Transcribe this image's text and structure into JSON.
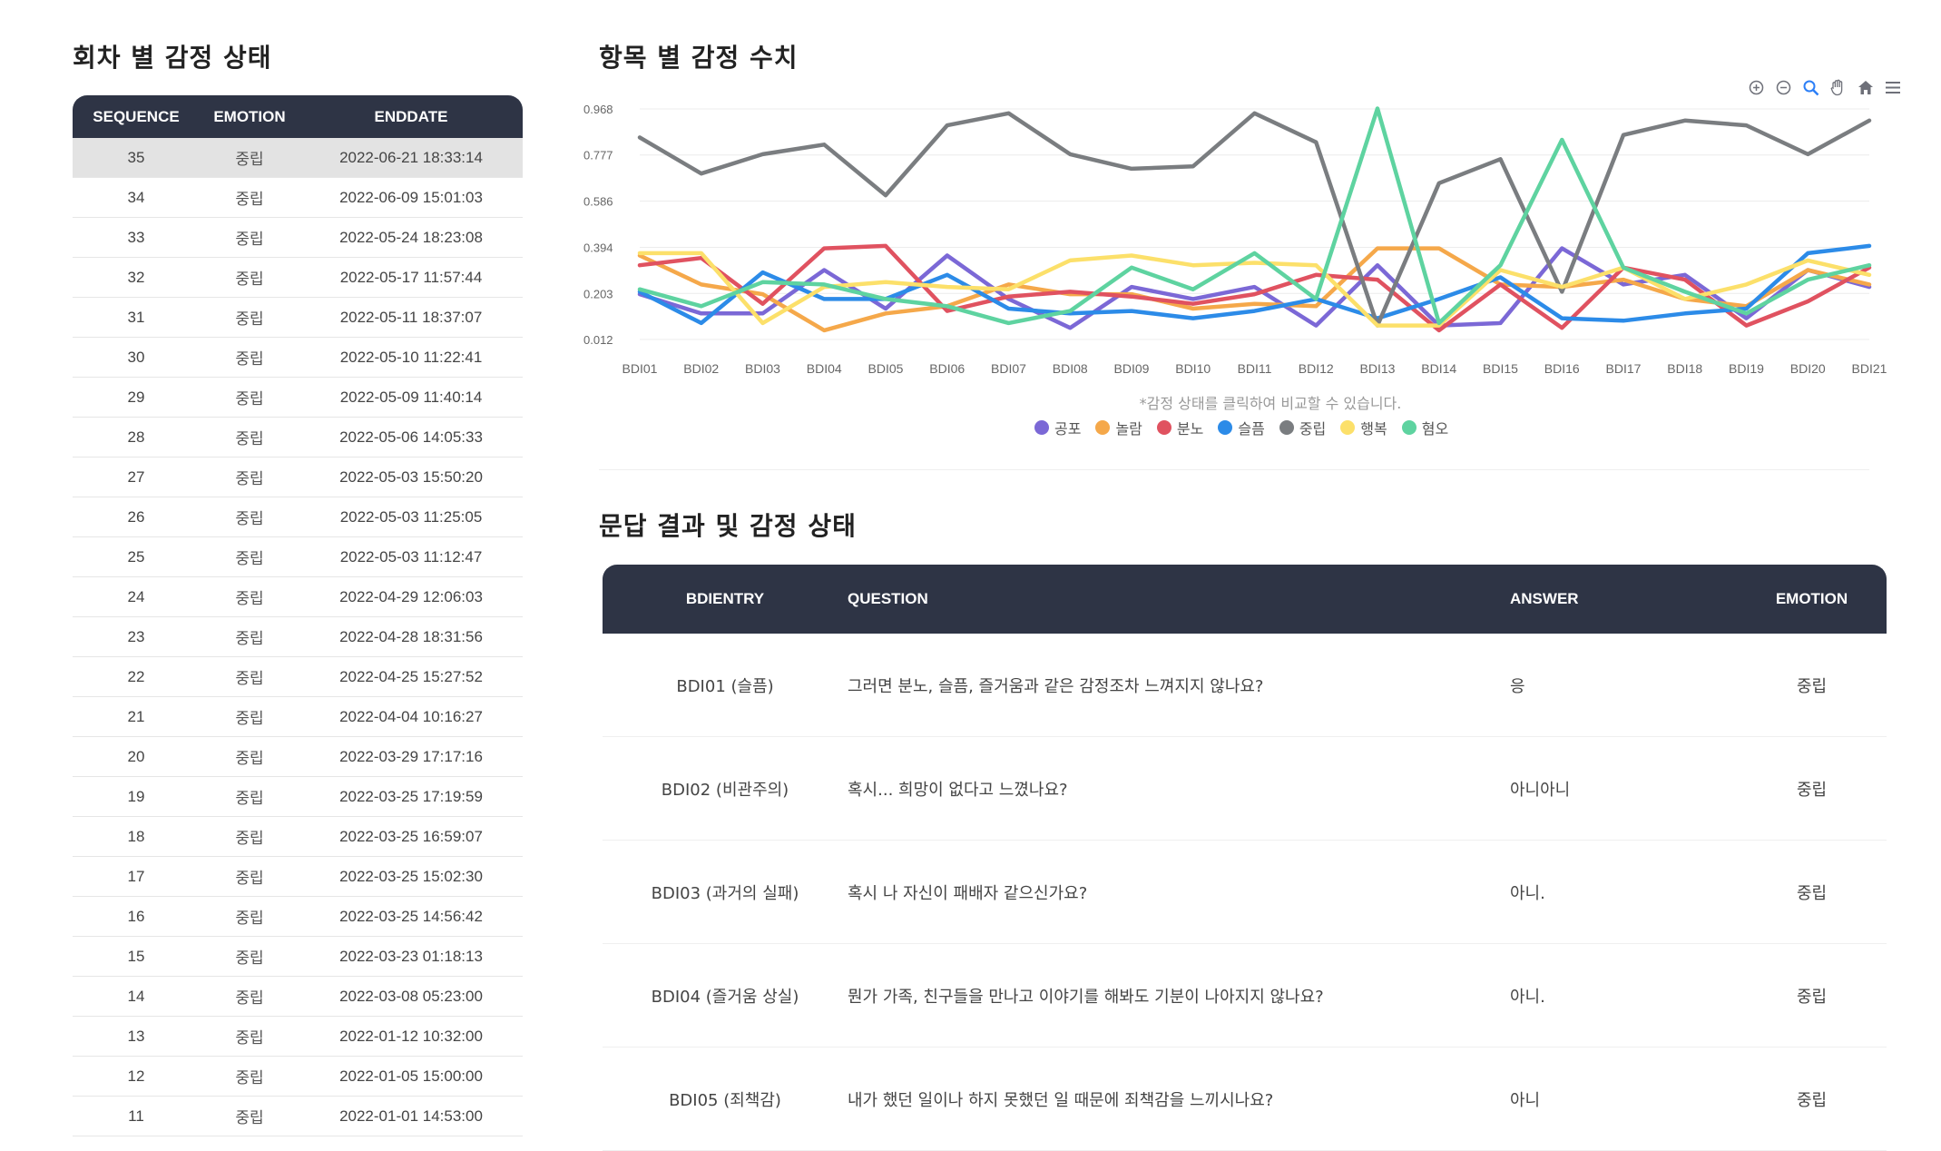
{
  "session_panel": {
    "title": "회차 별 감정 상태",
    "headers": [
      "SEQUENCE",
      "EMOTION",
      "ENDDATE"
    ],
    "rows": [
      {
        "seq": "35",
        "emotion": "중립",
        "end": "2022-06-21 18:33:14"
      },
      {
        "seq": "34",
        "emotion": "중립",
        "end": "2022-06-09 15:01:03"
      },
      {
        "seq": "33",
        "emotion": "중립",
        "end": "2022-05-24 18:23:08"
      },
      {
        "seq": "32",
        "emotion": "중립",
        "end": "2022-05-17 11:57:44"
      },
      {
        "seq": "31",
        "emotion": "중립",
        "end": "2022-05-11 18:37:07"
      },
      {
        "seq": "30",
        "emotion": "중립",
        "end": "2022-05-10 11:22:41"
      },
      {
        "seq": "29",
        "emotion": "중립",
        "end": "2022-05-09 11:40:14"
      },
      {
        "seq": "28",
        "emotion": "중립",
        "end": "2022-05-06 14:05:33"
      },
      {
        "seq": "27",
        "emotion": "중립",
        "end": "2022-05-03 15:50:20"
      },
      {
        "seq": "26",
        "emotion": "중립",
        "end": "2022-05-03 11:25:05"
      },
      {
        "seq": "25",
        "emotion": "중립",
        "end": "2022-05-03 11:12:47"
      },
      {
        "seq": "24",
        "emotion": "중립",
        "end": "2022-04-29 12:06:03"
      },
      {
        "seq": "23",
        "emotion": "중립",
        "end": "2022-04-28 18:31:56"
      },
      {
        "seq": "22",
        "emotion": "중립",
        "end": "2022-04-25 15:27:52"
      },
      {
        "seq": "21",
        "emotion": "중립",
        "end": "2022-04-04 10:16:27"
      },
      {
        "seq": "20",
        "emotion": "중립",
        "end": "2022-03-29 17:17:16"
      },
      {
        "seq": "19",
        "emotion": "중립",
        "end": "2022-03-25 17:19:59"
      },
      {
        "seq": "18",
        "emotion": "중립",
        "end": "2022-03-25 16:59:07"
      },
      {
        "seq": "17",
        "emotion": "중립",
        "end": "2022-03-25 15:02:30"
      },
      {
        "seq": "16",
        "emotion": "중립",
        "end": "2022-03-25 14:56:42"
      },
      {
        "seq": "15",
        "emotion": "중립",
        "end": "2022-03-23 01:18:13"
      },
      {
        "seq": "14",
        "emotion": "중립",
        "end": "2022-03-08 05:23:00"
      },
      {
        "seq": "13",
        "emotion": "중립",
        "end": "2022-01-12 10:32:00"
      },
      {
        "seq": "12",
        "emotion": "중립",
        "end": "2022-01-05 15:00:00"
      },
      {
        "seq": "11",
        "emotion": "중립",
        "end": "2022-01-01 14:53:00"
      }
    ]
  },
  "chart_panel": {
    "title": "항목 별 감정 수치",
    "note": "*감정 상태를 클릭하여 비교할 수 있습니다.",
    "toolbar_icons": [
      "zoom-in-icon",
      "zoom-out-icon",
      "selection-zoom-icon",
      "pan-hand-icon",
      "home-reset-icon",
      "menu-icon"
    ]
  },
  "chart_data": {
    "type": "line",
    "categories": [
      "BDI01",
      "BDI02",
      "BDI03",
      "BDI04",
      "BDI05",
      "BDI06",
      "BDI07",
      "BDI08",
      "BDI09",
      "BDI10",
      "BDI11",
      "BDI12",
      "BDI13",
      "BDI14",
      "BDI15",
      "BDI16",
      "BDI17",
      "BDI18",
      "BDI19",
      "BDI20",
      "BDI21"
    ],
    "y_ticks": [
      "0.968",
      "0.777",
      "0.586",
      "0.394",
      "0.203",
      "0.012"
    ],
    "ylim": [
      0.012,
      0.968
    ],
    "grid": true,
    "legend_position": "bottom",
    "series": [
      {
        "name": "공포",
        "color": "#7b68d6",
        "values": [
          0.2,
          0.12,
          0.12,
          0.3,
          0.14,
          0.36,
          0.18,
          0.06,
          0.23,
          0.18,
          0.23,
          0.07,
          0.32,
          0.07,
          0.08,
          0.39,
          0.24,
          0.28,
          0.1,
          0.3,
          0.23
        ]
      },
      {
        "name": "놀람",
        "color": "#f5a84a",
        "values": [
          0.36,
          0.24,
          0.2,
          0.05,
          0.12,
          0.15,
          0.24,
          0.2,
          0.2,
          0.14,
          0.16,
          0.15,
          0.39,
          0.39,
          0.24,
          0.23,
          0.26,
          0.18,
          0.15,
          0.3,
          0.24
        ]
      },
      {
        "name": "분노",
        "color": "#e05260",
        "values": [
          0.32,
          0.35,
          0.16,
          0.39,
          0.4,
          0.13,
          0.19,
          0.21,
          0.19,
          0.16,
          0.2,
          0.28,
          0.26,
          0.05,
          0.24,
          0.06,
          0.31,
          0.26,
          0.07,
          0.17,
          0.31
        ]
      },
      {
        "name": "슬픔",
        "color": "#2c8be8",
        "values": [
          0.21,
          0.08,
          0.29,
          0.18,
          0.18,
          0.28,
          0.14,
          0.12,
          0.13,
          0.1,
          0.13,
          0.18,
          0.1,
          0.18,
          0.27,
          0.1,
          0.09,
          0.12,
          0.14,
          0.37,
          0.4
        ]
      },
      {
        "name": "중립",
        "color": "#7a7d80",
        "values": [
          0.85,
          0.7,
          0.78,
          0.82,
          0.61,
          0.9,
          0.95,
          0.78,
          0.72,
          0.73,
          0.95,
          0.83,
          0.07,
          0.66,
          0.76,
          0.21,
          0.86,
          0.92,
          0.9,
          0.78,
          0.92
        ]
      },
      {
        "name": "행복",
        "color": "#fce06a",
        "values": [
          0.37,
          0.37,
          0.08,
          0.23,
          0.25,
          0.23,
          0.22,
          0.34,
          0.36,
          0.32,
          0.33,
          0.32,
          0.07,
          0.07,
          0.3,
          0.23,
          0.31,
          0.18,
          0.24,
          0.34,
          0.28
        ]
      },
      {
        "name": "혐오",
        "color": "#5ed3a0",
        "values": [
          0.22,
          0.15,
          0.25,
          0.24,
          0.18,
          0.15,
          0.08,
          0.13,
          0.31,
          0.22,
          0.37,
          0.18,
          0.97,
          0.08,
          0.32,
          0.84,
          0.31,
          0.21,
          0.12,
          0.26,
          0.32
        ]
      }
    ]
  },
  "answers_panel": {
    "title": "문답 결과 및 감정 상태",
    "headers": [
      "BDIENTRY",
      "QUESTION",
      "ANSWER",
      "EMOTION"
    ],
    "rows": [
      {
        "entry": "BDI01 (슬픔)",
        "question": "그러면 분노, 슬픔, 즐거움과 같은 감정조차 느껴지지 않나요?",
        "answer": "응",
        "emotion": "중립"
      },
      {
        "entry": "BDI02 (비관주의)",
        "question": "혹시... 희망이 없다고 느꼈나요?",
        "answer": "아니아니",
        "emotion": "중립"
      },
      {
        "entry": "BDI03 (과거의 실패)",
        "question": "혹시 나 자신이 패배자 같으신가요?",
        "answer": "아니.",
        "emotion": "중립"
      },
      {
        "entry": "BDI04 (즐거움 상실)",
        "question": "뭔가 가족, 친구들을 만나고 이야기를 해봐도 기분이 나아지지 않나요?",
        "answer": "아니.",
        "emotion": "중립"
      },
      {
        "entry": "BDI05 (죄책감)",
        "question": "내가 했던 일이나 하지 못했던 일 때문에 죄책감을 느끼시나요?",
        "answer": "아니",
        "emotion": "중립"
      }
    ]
  }
}
